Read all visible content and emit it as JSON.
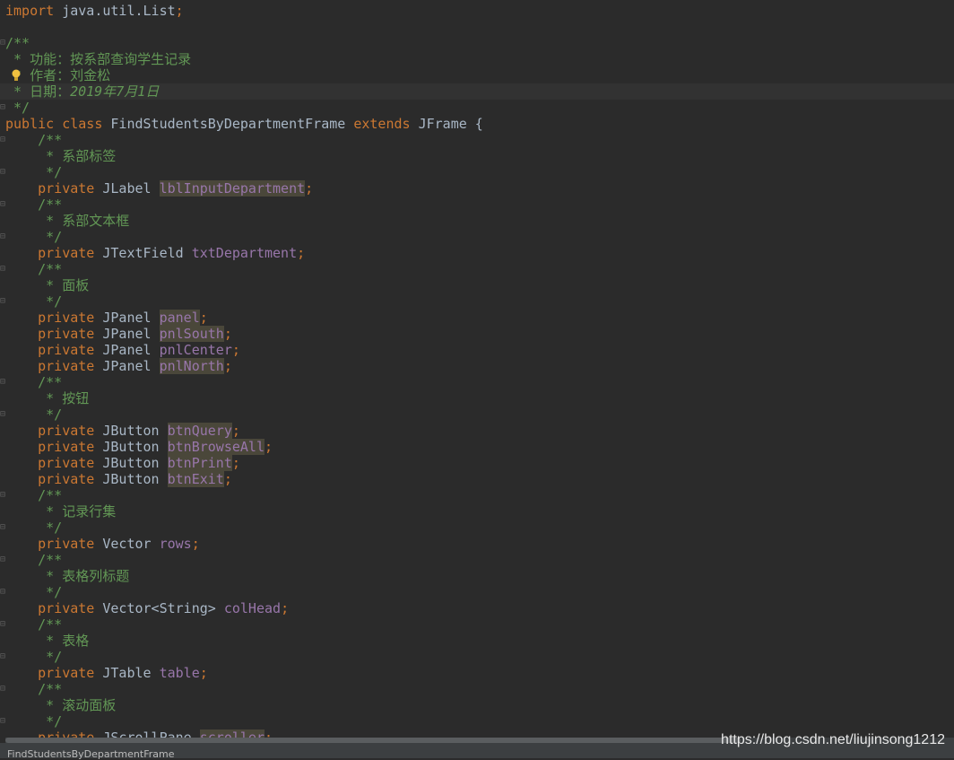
{
  "editor": {
    "lines": [
      {
        "gutter": "",
        "tokens": [
          {
            "t": "import ",
            "c": "kw"
          },
          {
            "t": "java.util.List",
            "c": ""
          },
          {
            "t": ";",
            "c": "kw"
          }
        ]
      },
      {
        "gutter": "",
        "tokens": []
      },
      {
        "gutter": "⊟",
        "tokens": [
          {
            "t": "/**",
            "c": "doc"
          }
        ]
      },
      {
        "gutter": "",
        "tokens": [
          {
            "t": " * 功能：按系部查询学生记录",
            "c": "doc"
          }
        ]
      },
      {
        "gutter": "",
        "bulb": true,
        "tokens": [
          {
            "t": " * 作者：刘金松",
            "c": "doc"
          }
        ]
      },
      {
        "gutter": "",
        "caret": true,
        "tokens": [
          {
            "t": " * 日期：",
            "c": "doc"
          },
          {
            "t": "2019年7月1日",
            "c": "docit"
          }
        ]
      },
      {
        "gutter": "⊟",
        "tokens": [
          {
            "t": " */",
            "c": "doc"
          }
        ]
      },
      {
        "gutter": "",
        "tokens": [
          {
            "t": "public class ",
            "c": "kw"
          },
          {
            "t": "FindStudentsByDepartmentFrame ",
            "c": ""
          },
          {
            "t": "extends ",
            "c": "kw"
          },
          {
            "t": "JFrame {",
            "c": ""
          }
        ]
      },
      {
        "gutter": "⊟",
        "tokens": [
          {
            "t": "    /**",
            "c": "doc"
          }
        ]
      },
      {
        "gutter": "",
        "tokens": [
          {
            "t": "     * 系部标签",
            "c": "doc"
          }
        ]
      },
      {
        "gutter": "⊟",
        "tokens": [
          {
            "t": "     */",
            "c": "doc"
          }
        ]
      },
      {
        "gutter": "",
        "tokens": [
          {
            "t": "    private ",
            "c": "kw"
          },
          {
            "t": "JLabel ",
            "c": ""
          },
          {
            "t": "lblInputDepartment",
            "c": "fld hl"
          },
          {
            "t": ";",
            "c": "kw"
          }
        ]
      },
      {
        "gutter": "⊟",
        "tokens": [
          {
            "t": "    /**",
            "c": "doc"
          }
        ]
      },
      {
        "gutter": "",
        "tokens": [
          {
            "t": "     * 系部文本框",
            "c": "doc"
          }
        ]
      },
      {
        "gutter": "⊟",
        "tokens": [
          {
            "t": "     */",
            "c": "doc"
          }
        ]
      },
      {
        "gutter": "",
        "tokens": [
          {
            "t": "    private ",
            "c": "kw"
          },
          {
            "t": "JTextField ",
            "c": ""
          },
          {
            "t": "txtDepartment",
            "c": "fld"
          },
          {
            "t": ";",
            "c": "kw"
          }
        ]
      },
      {
        "gutter": "⊟",
        "tokens": [
          {
            "t": "    /**",
            "c": "doc"
          }
        ]
      },
      {
        "gutter": "",
        "tokens": [
          {
            "t": "     * 面板",
            "c": "doc"
          }
        ]
      },
      {
        "gutter": "⊟",
        "tokens": [
          {
            "t": "     */",
            "c": "doc"
          }
        ]
      },
      {
        "gutter": "",
        "tokens": [
          {
            "t": "    private ",
            "c": "kw"
          },
          {
            "t": "JPanel ",
            "c": ""
          },
          {
            "t": "panel",
            "c": "fld hl"
          },
          {
            "t": ";",
            "c": "kw"
          }
        ]
      },
      {
        "gutter": "",
        "tokens": [
          {
            "t": "    private ",
            "c": "kw"
          },
          {
            "t": "JPanel ",
            "c": ""
          },
          {
            "t": "pnlSouth",
            "c": "fld hl"
          },
          {
            "t": ";",
            "c": "kw"
          }
        ]
      },
      {
        "gutter": "",
        "tokens": [
          {
            "t": "    private ",
            "c": "kw"
          },
          {
            "t": "JPanel ",
            "c": ""
          },
          {
            "t": "pnlCenter",
            "c": "fld"
          },
          {
            "t": ";",
            "c": "kw"
          }
        ]
      },
      {
        "gutter": "",
        "tokens": [
          {
            "t": "    private ",
            "c": "kw"
          },
          {
            "t": "JPanel ",
            "c": ""
          },
          {
            "t": "pnlNorth",
            "c": "fld hl"
          },
          {
            "t": ";",
            "c": "kw"
          }
        ]
      },
      {
        "gutter": "⊟",
        "tokens": [
          {
            "t": "    /**",
            "c": "doc"
          }
        ]
      },
      {
        "gutter": "",
        "tokens": [
          {
            "t": "     * 按钮",
            "c": "doc"
          }
        ]
      },
      {
        "gutter": "⊟",
        "tokens": [
          {
            "t": "     */",
            "c": "doc"
          }
        ]
      },
      {
        "gutter": "",
        "tokens": [
          {
            "t": "    private ",
            "c": "kw"
          },
          {
            "t": "JButton ",
            "c": ""
          },
          {
            "t": "btnQuery",
            "c": "fld hl"
          },
          {
            "t": ";",
            "c": "kw"
          }
        ]
      },
      {
        "gutter": "",
        "tokens": [
          {
            "t": "    private ",
            "c": "kw"
          },
          {
            "t": "JButton ",
            "c": ""
          },
          {
            "t": "btnBrowseAll",
            "c": "fld hl"
          },
          {
            "t": ";",
            "c": "kw"
          }
        ]
      },
      {
        "gutter": "",
        "tokens": [
          {
            "t": "    private ",
            "c": "kw"
          },
          {
            "t": "JButton ",
            "c": ""
          },
          {
            "t": "btnPrint",
            "c": "fld hl"
          },
          {
            "t": ";",
            "c": "kw"
          }
        ]
      },
      {
        "gutter": "",
        "tokens": [
          {
            "t": "    private ",
            "c": "kw"
          },
          {
            "t": "JButton ",
            "c": ""
          },
          {
            "t": "btnExit",
            "c": "fld hl"
          },
          {
            "t": ";",
            "c": "kw"
          }
        ]
      },
      {
        "gutter": "⊟",
        "tokens": [
          {
            "t": "    /**",
            "c": "doc"
          }
        ]
      },
      {
        "gutter": "",
        "tokens": [
          {
            "t": "     * 记录行集",
            "c": "doc"
          }
        ]
      },
      {
        "gutter": "⊟",
        "tokens": [
          {
            "t": "     */",
            "c": "doc"
          }
        ]
      },
      {
        "gutter": "",
        "tokens": [
          {
            "t": "    private ",
            "c": "kw"
          },
          {
            "t": "Vector ",
            "c": ""
          },
          {
            "t": "rows",
            "c": "fld"
          },
          {
            "t": ";",
            "c": "kw"
          }
        ]
      },
      {
        "gutter": "⊟",
        "tokens": [
          {
            "t": "    /**",
            "c": "doc"
          }
        ]
      },
      {
        "gutter": "",
        "tokens": [
          {
            "t": "     * 表格列标题",
            "c": "doc"
          }
        ]
      },
      {
        "gutter": "⊟",
        "tokens": [
          {
            "t": "     */",
            "c": "doc"
          }
        ]
      },
      {
        "gutter": "",
        "tokens": [
          {
            "t": "    private ",
            "c": "kw"
          },
          {
            "t": "Vector<String> ",
            "c": ""
          },
          {
            "t": "colHead",
            "c": "fld"
          },
          {
            "t": ";",
            "c": "kw"
          }
        ]
      },
      {
        "gutter": "⊟",
        "tokens": [
          {
            "t": "    /**",
            "c": "doc"
          }
        ]
      },
      {
        "gutter": "",
        "tokens": [
          {
            "t": "     * 表格",
            "c": "doc"
          }
        ]
      },
      {
        "gutter": "⊟",
        "tokens": [
          {
            "t": "     */",
            "c": "doc"
          }
        ]
      },
      {
        "gutter": "",
        "tokens": [
          {
            "t": "    private ",
            "c": "kw"
          },
          {
            "t": "JTable ",
            "c": ""
          },
          {
            "t": "table",
            "c": "fld"
          },
          {
            "t": ";",
            "c": "kw"
          }
        ]
      },
      {
        "gutter": "⊟",
        "tokens": [
          {
            "t": "    /**",
            "c": "doc"
          }
        ]
      },
      {
        "gutter": "",
        "tokens": [
          {
            "t": "     * 滚动面板",
            "c": "doc"
          }
        ]
      },
      {
        "gutter": "⊟",
        "tokens": [
          {
            "t": "     */",
            "c": "doc"
          }
        ]
      },
      {
        "gutter": "",
        "tokens": [
          {
            "t": "    private ",
            "c": "kw"
          },
          {
            "t": "JScrollPane ",
            "c": ""
          },
          {
            "t": "scroller",
            "c": "fld hl"
          },
          {
            "t": ";",
            "c": "kw"
          }
        ]
      }
    ]
  },
  "statusbar": {
    "breadcrumb": "FindStudentsByDepartmentFrame"
  },
  "watermark": "https://blog.csdn.net/liujinsong1212",
  "colors": {
    "background": "#2b2b2b",
    "keyword": "#cc7832",
    "field": "#9876aa",
    "doc": "#629755",
    "text": "#a9b7c6",
    "highlight": "#4a473a"
  }
}
